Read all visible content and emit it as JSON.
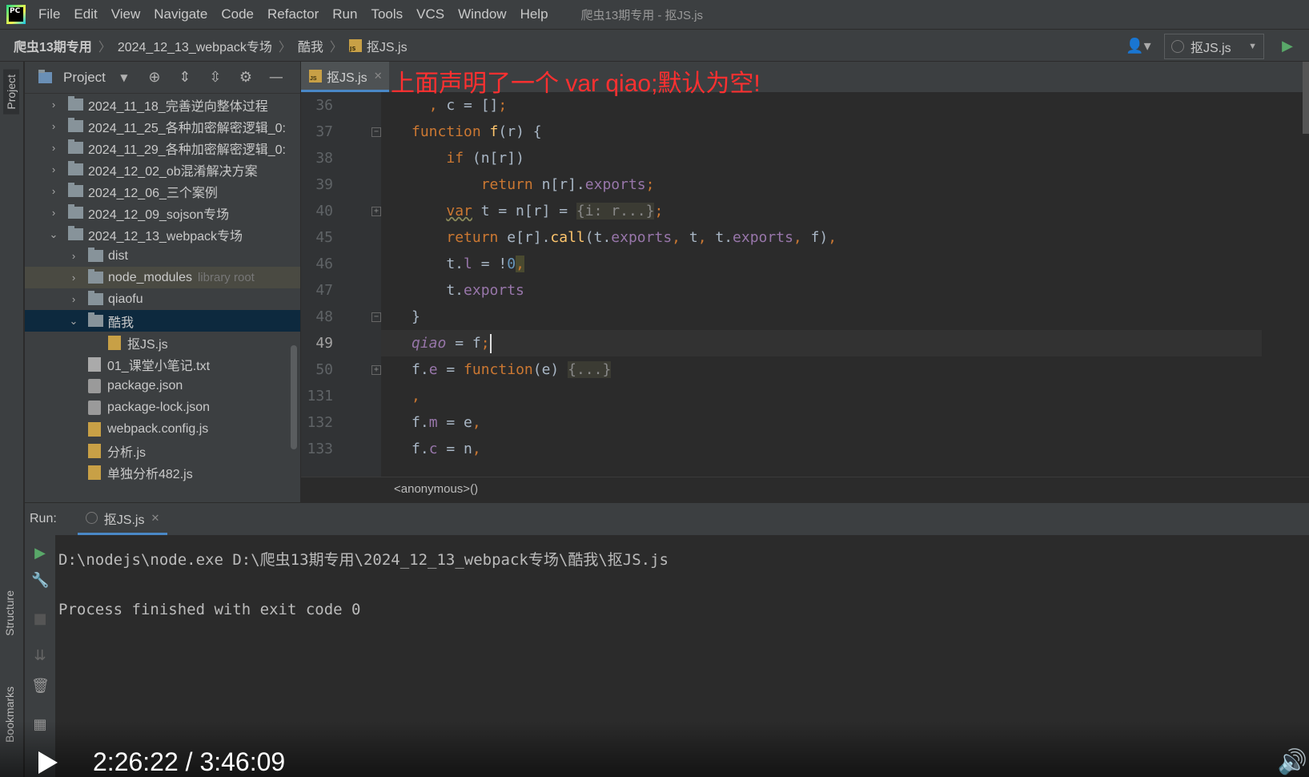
{
  "menubar": {
    "items": [
      "File",
      "Edit",
      "View",
      "Navigate",
      "Code",
      "Refactor",
      "Run",
      "Tools",
      "VCS",
      "Window",
      "Help"
    ],
    "window_title": "爬虫13期专用 - 抠JS.js",
    "logo_text": "PC"
  },
  "navbar": {
    "crumbs": [
      "爬虫13期专用",
      "2024_12_13_webpack专场",
      "酷我",
      "抠JS.js"
    ],
    "run_config": "抠JS.js"
  },
  "side_strip": {
    "project": "Project",
    "structure": "Structure",
    "bookmarks": "Bookmarks"
  },
  "project_panel": {
    "title": "Project",
    "tree": [
      {
        "label": "2024_11_18_完善逆向整体过程",
        "type": "folder",
        "depth": 1,
        "expanded": false
      },
      {
        "label": "2024_11_25_各种加密解密逻辑_0:",
        "type": "folder",
        "depth": 1,
        "expanded": false
      },
      {
        "label": "2024_11_29_各种加密解密逻辑_0:",
        "type": "folder",
        "depth": 1,
        "expanded": false
      },
      {
        "label": "2024_12_02_ob混淆解决方案",
        "type": "folder",
        "depth": 1,
        "expanded": false
      },
      {
        "label": "2024_12_06_三个案例",
        "type": "folder",
        "depth": 1,
        "expanded": false
      },
      {
        "label": "2024_12_09_sojson专场",
        "type": "folder",
        "depth": 1,
        "expanded": false
      },
      {
        "label": "2024_12_13_webpack专场",
        "type": "folder",
        "depth": 1,
        "expanded": true
      },
      {
        "label": "dist",
        "type": "folder",
        "depth": 2,
        "expanded": false
      },
      {
        "label": "node_modules",
        "suffix": "library root",
        "type": "folder",
        "depth": 2,
        "expanded": false,
        "state": "highlight"
      },
      {
        "label": "qiaofu",
        "type": "folder",
        "depth": 2,
        "expanded": false
      },
      {
        "label": "酷我",
        "type": "folder",
        "depth": 2,
        "expanded": true,
        "state": "selected"
      },
      {
        "label": "抠JS.js",
        "type": "js",
        "depth": 3
      },
      {
        "label": "01_课堂小笔记.txt",
        "type": "txt",
        "depth": 2
      },
      {
        "label": "package.json",
        "type": "json",
        "depth": 2
      },
      {
        "label": "package-lock.json",
        "type": "json",
        "depth": 2
      },
      {
        "label": "webpack.config.js",
        "type": "js",
        "depth": 2
      },
      {
        "label": "分析.js",
        "type": "js",
        "depth": 2
      },
      {
        "label": "单独分析482.js",
        "type": "js",
        "depth": 2
      }
    ]
  },
  "editor": {
    "tab": "抠JS.js",
    "annotation": "上面声明了一个 var qiao;默认为空!",
    "current_line": "49",
    "line_numbers": [
      "36",
      "37",
      "38",
      "39",
      "40",
      "45",
      "46",
      "47",
      "48",
      "49",
      "50",
      "131",
      "132",
      "133"
    ],
    "footer_breadcrumb": "<anonymous>()"
  },
  "run_panel": {
    "label": "Run:",
    "tab": "抠JS.js",
    "console": [
      "D:\\nodejs\\node.exe D:\\爬虫13期专用\\2024_12_13_webpack专场\\酷我\\抠JS.js",
      "",
      "Process finished with exit code 0"
    ]
  },
  "video": {
    "timecode": "2:26:22 / 3:46:09"
  },
  "colors": {
    "keyword": "#cc7832",
    "function": "#ffc66d",
    "property": "#9876aa",
    "number": "#6897bb",
    "annotation": "#ff3030",
    "selection": "#0d293e"
  }
}
